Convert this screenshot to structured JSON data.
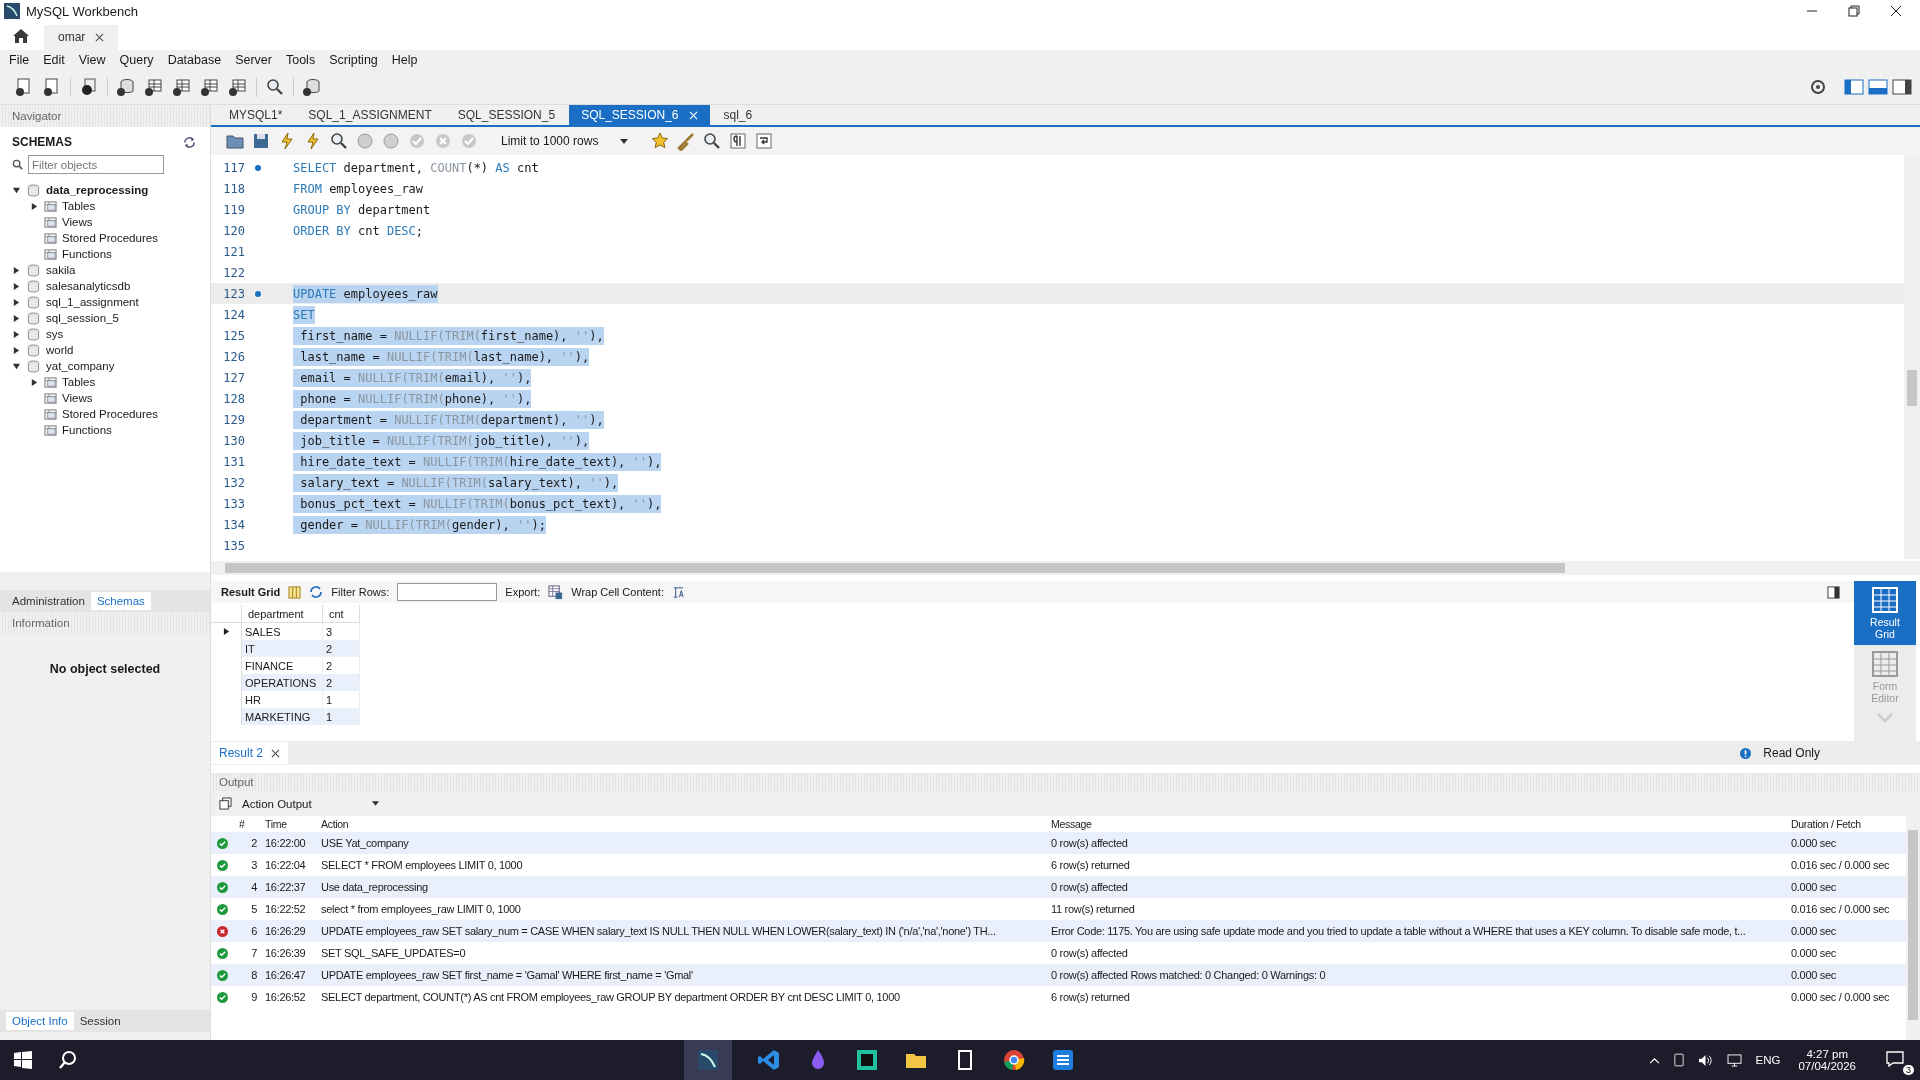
{
  "window": {
    "title": "MySQL Workbench"
  },
  "connection_tabs": [
    {
      "label": "omar",
      "selected": true
    }
  ],
  "menu": [
    "File",
    "Edit",
    "View",
    "Query",
    "Database",
    "Server",
    "Tools",
    "Scripting",
    "Help"
  ],
  "navigator": {
    "title": "Navigator",
    "section": "SCHEMAS",
    "filter_placeholder": "Filter objects",
    "schemas": [
      {
        "label": "data_reprocessing",
        "default": true,
        "expanded": true,
        "children": [
          {
            "label": "Tables",
            "expandable": true
          },
          {
            "label": "Views",
            "expandable": false
          },
          {
            "label": "Stored Procedures",
            "expandable": false
          },
          {
            "label": "Functions",
            "expandable": false
          }
        ]
      },
      {
        "label": "sakila",
        "default": false,
        "expanded": false
      },
      {
        "label": "salesanalyticsdb",
        "default": false,
        "expanded": false
      },
      {
        "label": "sql_1_assignment",
        "default": false,
        "expanded": false
      },
      {
        "label": "sql_session_5",
        "default": false,
        "expanded": false
      },
      {
        "label": "sys",
        "default": false,
        "expanded": false
      },
      {
        "label": "world",
        "default": false,
        "expanded": false
      },
      {
        "label": "yat_company",
        "default": false,
        "expanded": true,
        "children": [
          {
            "label": "Tables",
            "expandable": true
          },
          {
            "label": "Views",
            "expandable": false
          },
          {
            "label": "Stored Procedures",
            "expandable": false
          },
          {
            "label": "Functions",
            "expandable": false
          }
        ]
      }
    ],
    "bottom_tabs": [
      {
        "label": "Administration",
        "selected": false
      },
      {
        "label": "Schemas",
        "selected": true
      }
    ],
    "information": {
      "title": "Information",
      "text": "No object selected"
    },
    "info_tabs": [
      {
        "label": "Object Info",
        "selected": true
      },
      {
        "label": "Session",
        "selected": false
      }
    ]
  },
  "query_tabs": [
    {
      "label": "MYSQL1*",
      "selected": false
    },
    {
      "label": "SQL_1_ASSIGNMENT",
      "selected": false
    },
    {
      "label": "SQL_SESSION_5",
      "selected": false
    },
    {
      "label": "SQL_SESSION_6",
      "selected": true
    },
    {
      "label": "sql_6",
      "selected": false
    }
  ],
  "limit_dropdown": "Limit to 1000 rows",
  "editor": {
    "lines": [
      {
        "number": "117",
        "marker": true,
        "selected": false,
        "current": false,
        "tokens": [
          {
            "kind": "kw",
            "text": "SELECT"
          },
          {
            "kind": "txt",
            "text": " department, "
          },
          {
            "kind": "fn",
            "text": "COUNT"
          },
          {
            "kind": "txt",
            "text": "(*) "
          },
          {
            "kind": "kw",
            "text": "AS"
          },
          {
            "kind": "txt",
            "text": " cnt"
          }
        ]
      },
      {
        "number": "118",
        "marker": false,
        "selected": false,
        "current": false,
        "tokens": [
          {
            "kind": "kw",
            "text": "FROM"
          },
          {
            "kind": "txt",
            "text": " employees_raw"
          }
        ]
      },
      {
        "number": "119",
        "marker": false,
        "selected": false,
        "current": false,
        "tokens": [
          {
            "kind": "kw",
            "text": "GROUP BY"
          },
          {
            "kind": "txt",
            "text": " department"
          }
        ]
      },
      {
        "number": "120",
        "marker": false,
        "selected": false,
        "current": false,
        "tokens": [
          {
            "kind": "kw",
            "text": "ORDER BY"
          },
          {
            "kind": "txt",
            "text": " cnt "
          },
          {
            "kind": "kw",
            "text": "DESC"
          },
          {
            "kind": "txt",
            "text": ";"
          }
        ]
      },
      {
        "number": "121",
        "marker": false,
        "selected": false,
        "current": false
      },
      {
        "number": "122",
        "marker": false,
        "selected": false,
        "current": false
      },
      {
        "number": "123",
        "marker": true,
        "selected": true,
        "current": true,
        "tokens": [
          {
            "kind": "kw",
            "text": "UPDATE"
          },
          {
            "kind": "txt",
            "text": " employees_raw"
          }
        ]
      },
      {
        "number": "124",
        "marker": false,
        "selected": true,
        "current": false,
        "tokens": [
          {
            "kind": "kw",
            "text": "SET"
          }
        ]
      },
      {
        "number": "125",
        "marker": false,
        "selected": true,
        "current": false,
        "tokens": [
          {
            "kind": "txt",
            "text": " first_name = "
          },
          {
            "kind": "fn",
            "text": "NULLIF(TRIM("
          },
          {
            "kind": "txt",
            "text": "first_name), "
          },
          {
            "kind": "fn",
            "text": "''"
          },
          {
            "kind": "txt",
            "text": "),"
          }
        ]
      },
      {
        "number": "126",
        "marker": false,
        "selected": true,
        "current": false,
        "tokens": [
          {
            "kind": "txt",
            "text": " last_name = "
          },
          {
            "kind": "fn",
            "text": "NULLIF(TRIM("
          },
          {
            "kind": "txt",
            "text": "last_name), "
          },
          {
            "kind": "fn",
            "text": "''"
          },
          {
            "kind": "txt",
            "text": "),"
          }
        ]
      },
      {
        "number": "127",
        "marker": false,
        "selected": true,
        "current": false,
        "tokens": [
          {
            "kind": "txt",
            "text": " email = "
          },
          {
            "kind": "fn",
            "text": "NULLIF(TRIM("
          },
          {
            "kind": "txt",
            "text": "email), "
          },
          {
            "kind": "fn",
            "text": "''"
          },
          {
            "kind": "txt",
            "text": "),"
          }
        ]
      },
      {
        "number": "128",
        "marker": false,
        "selected": true,
        "current": false,
        "tokens": [
          {
            "kind": "txt",
            "text": " phone = "
          },
          {
            "kind": "fn",
            "text": "NULLIF(TRIM("
          },
          {
            "kind": "txt",
            "text": "phone), "
          },
          {
            "kind": "fn",
            "text": "''"
          },
          {
            "kind": "txt",
            "text": "),"
          }
        ]
      },
      {
        "number": "129",
        "marker": false,
        "selected": true,
        "current": false,
        "tokens": [
          {
            "kind": "txt",
            "text": " department = "
          },
          {
            "kind": "fn",
            "text": "NULLIF(TRIM("
          },
          {
            "kind": "txt",
            "text": "department), "
          },
          {
            "kind": "fn",
            "text": "''"
          },
          {
            "kind": "txt",
            "text": "),"
          }
        ]
      },
      {
        "number": "130",
        "marker": false,
        "selected": true,
        "current": false,
        "tokens": [
          {
            "kind": "txt",
            "text": " job_title = "
          },
          {
            "kind": "fn",
            "text": "NULLIF(TRIM("
          },
          {
            "kind": "txt",
            "text": "job_title), "
          },
          {
            "kind": "fn",
            "text": "''"
          },
          {
            "kind": "txt",
            "text": "),"
          }
        ]
      },
      {
        "number": "131",
        "marker": false,
        "selected": true,
        "current": false,
        "tokens": [
          {
            "kind": "txt",
            "text": " hire_date_text = "
          },
          {
            "kind": "fn",
            "text": "NULLIF(TRIM("
          },
          {
            "kind": "txt",
            "text": "hire_date_text), "
          },
          {
            "kind": "fn",
            "text": "''"
          },
          {
            "kind": "txt",
            "text": "),"
          }
        ]
      },
      {
        "number": "132",
        "marker": false,
        "selected": true,
        "current": false,
        "tokens": [
          {
            "kind": "txt",
            "text": " salary_text = "
          },
          {
            "kind": "fn",
            "text": "NULLIF(TRIM("
          },
          {
            "kind": "txt",
            "text": "salary_text), "
          },
          {
            "kind": "fn",
            "text": "''"
          },
          {
            "kind": "txt",
            "text": "),"
          }
        ]
      },
      {
        "number": "133",
        "marker": false,
        "selected": true,
        "current": false,
        "tokens": [
          {
            "kind": "txt",
            "text": " bonus_pct_text = "
          },
          {
            "kind": "fn",
            "text": "NULLIF(TRIM("
          },
          {
            "kind": "txt",
            "text": "bonus_pct_text), "
          },
          {
            "kind": "fn",
            "text": "''"
          },
          {
            "kind": "txt",
            "text": "),"
          }
        ]
      },
      {
        "number": "134",
        "marker": false,
        "selected": true,
        "current": false,
        "tokens": [
          {
            "kind": "txt",
            "text": " gender = "
          },
          {
            "kind": "fn",
            "text": "NULLIF(TRIM("
          },
          {
            "kind": "txt",
            "text": "gender), "
          },
          {
            "kind": "fn",
            "text": "''"
          },
          {
            "kind": "txt",
            "text": ");"
          }
        ]
      },
      {
        "number": "135",
        "marker": false,
        "selected": false,
        "current": false
      }
    ]
  },
  "result_toolbar": {
    "title": "Result Grid",
    "filter_label": "Filter Rows:",
    "export_label": "Export:",
    "wrap_label": "Wrap Cell Content:"
  },
  "result_grid": {
    "columns": [
      "department",
      "cnt"
    ],
    "rows": [
      {
        "cells": [
          "SALES",
          "3"
        ],
        "current": true
      },
      {
        "cells": [
          "IT",
          "2"
        ],
        "current": false
      },
      {
        "cells": [
          "FINANCE",
          "2"
        ],
        "current": false
      },
      {
        "cells": [
          "OPERATIONS",
          "2"
        ],
        "current": false
      },
      {
        "cells": [
          "HR",
          "1"
        ],
        "current": false
      },
      {
        "cells": [
          "MARKETING",
          "1"
        ],
        "current": false
      }
    ]
  },
  "side_views": [
    {
      "label": "Result Grid",
      "selected": true
    },
    {
      "label": "Form Editor",
      "selected": false
    }
  ],
  "result_tabs": [
    {
      "label": "Result 2",
      "selected": true
    }
  ],
  "read_only": "Read Only",
  "output": {
    "title": "Output",
    "mode": "Action Output",
    "columns": [
      "#",
      "Time",
      "Action",
      "Message",
      "Duration / Fetch"
    ],
    "rows": [
      {
        "error": false,
        "number": "2",
        "time": "16:22:00",
        "action": "USE Yat_company",
        "message": "0 row(s) affected",
        "duration": "0.000 sec"
      },
      {
        "error": false,
        "number": "3",
        "time": "16:22:04",
        "action": "SELECT * FROM employees LIMIT 0, 1000",
        "message": "6 row(s) returned",
        "duration": "0.016 sec / 0.000 sec"
      },
      {
        "error": false,
        "number": "4",
        "time": "16:22:37",
        "action": "Use data_reprocessing",
        "message": "0 row(s) affected",
        "duration": "0.000 sec"
      },
      {
        "error": false,
        "number": "5",
        "time": "16:22:52",
        "action": "select * from employees_raw LIMIT 0, 1000",
        "message": "11 row(s) returned",
        "duration": "0.016 sec / 0.000 sec"
      },
      {
        "error": true,
        "number": "6",
        "time": "16:26:29",
        "action": "UPDATE employees_raw SET salary_num = CASE     WHEN salary_text IS NULL THEN NULL     WHEN LOWER(salary_text) IN ('n/a','na','none') TH...",
        "message": "Error Code: 1175. You are using safe update mode and you tried to update a table without a WHERE that uses a KEY column.  To disable safe mode, t...",
        "duration": "0.000 sec"
      },
      {
        "error": false,
        "number": "7",
        "time": "16:26:39",
        "action": "SET  SQL_SAFE_UPDATES=0",
        "message": "0 row(s) affected",
        "duration": "0.000 sec"
      },
      {
        "error": false,
        "number": "8",
        "time": "16:26:47",
        "action": "UPDATE employees_raw SET first_name = 'Gamal' WHERE first_name = 'Gmal'",
        "message": "0 row(s) affected Rows matched: 0  Changed: 0  Warnings: 0",
        "duration": "0.000 sec"
      },
      {
        "error": false,
        "number": "9",
        "time": "16:26:52",
        "action": "SELECT department, COUNT(*) AS cnt FROM employees_raw GROUP BY department ORDER BY cnt DESC LIMIT 0, 1000",
        "message": "6 row(s) returned",
        "duration": "0.000 sec / 0.000 sec"
      }
    ]
  },
  "taskbar": {
    "language": "ENG",
    "time": "4:27 pm",
    "date": "07/04/2026",
    "notifications": "3"
  }
}
